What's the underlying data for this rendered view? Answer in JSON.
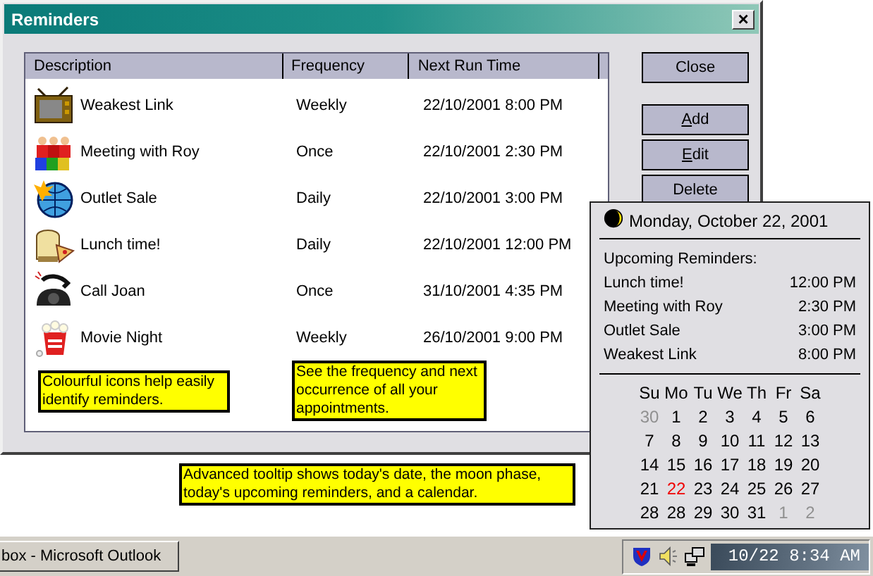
{
  "window": {
    "title": "Reminders",
    "close_glyph": "×"
  },
  "table": {
    "columns": [
      "Description",
      "Frequency",
      "Next Run Time"
    ],
    "rows": [
      {
        "kind": "tv",
        "description": "Weakest Link",
        "frequency": "Weekly",
        "next_run": "22/10/2001 8:00 PM"
      },
      {
        "kind": "people",
        "description": "Meeting with Roy",
        "frequency": "Once",
        "next_run": "22/10/2001 2:30 PM"
      },
      {
        "kind": "globe",
        "description": "Outlet Sale",
        "frequency": "Daily",
        "next_run": "22/10/2001 3:00 PM"
      },
      {
        "kind": "food",
        "description": "Lunch time!",
        "frequency": "Daily",
        "next_run": "22/10/2001 12:00 PM"
      },
      {
        "kind": "phone",
        "description": "Call Joan",
        "frequency": "Once",
        "next_run": "31/10/2001 4:35 PM"
      },
      {
        "kind": "popcorn",
        "description": "Movie Night",
        "frequency": "Weekly",
        "next_run": "26/10/2001 9:00 PM"
      }
    ]
  },
  "buttons": [
    {
      "label": "Close",
      "mnemonic": false
    },
    {
      "label": "Add",
      "mnemonic": true
    },
    {
      "label": "Edit",
      "mnemonic": true
    },
    {
      "label": "Delete",
      "mnemonic": false
    }
  ],
  "callouts": [
    "Colourful icons help easily identify reminders.",
    "See the frequency and next occurrence of all your appointments.",
    "Advanced tooltip shows today's date, the moon phase, today's upcoming reminders, and a calendar."
  ],
  "tooltip": {
    "date": "Monday, October 22, 2001",
    "upcoming_title": "Upcoming Reminders:",
    "upcoming": [
      {
        "name": "Lunch time!",
        "time": "12:00 PM"
      },
      {
        "name": "Meeting with Roy",
        "time": "2:30 PM"
      },
      {
        "name": "Outlet Sale",
        "time": "3:00 PM"
      },
      {
        "name": "Weakest Link",
        "time": "8:00 PM"
      }
    ],
    "calendar": {
      "weekdays": [
        "Su",
        "Mo",
        "Tu",
        "We",
        "Th",
        "Fr",
        "Sa"
      ],
      "weeks": [
        [
          {
            "day": "30",
            "kind": "other"
          },
          {
            "day": "1",
            "kind": "current"
          },
          {
            "day": "2",
            "kind": "current"
          },
          {
            "day": "3",
            "kind": "current"
          },
          {
            "day": "4",
            "kind": "current"
          },
          {
            "day": "5",
            "kind": "current"
          },
          {
            "day": "6",
            "kind": "current"
          }
        ],
        [
          {
            "day": "7",
            "kind": "current"
          },
          {
            "day": "8",
            "kind": "current"
          },
          {
            "day": "9",
            "kind": "current"
          },
          {
            "day": "10",
            "kind": "current"
          },
          {
            "day": "11",
            "kind": "current"
          },
          {
            "day": "12",
            "kind": "current"
          },
          {
            "day": "13",
            "kind": "current"
          }
        ],
        [
          {
            "day": "14",
            "kind": "current"
          },
          {
            "day": "15",
            "kind": "current"
          },
          {
            "day": "16",
            "kind": "current"
          },
          {
            "day": "17",
            "kind": "current"
          },
          {
            "day": "18",
            "kind": "current"
          },
          {
            "day": "19",
            "kind": "current"
          },
          {
            "day": "20",
            "kind": "current"
          }
        ],
        [
          {
            "day": "21",
            "kind": "current"
          },
          {
            "day": "22",
            "kind": "today"
          },
          {
            "day": "23",
            "kind": "current"
          },
          {
            "day": "24",
            "kind": "current"
          },
          {
            "day": "25",
            "kind": "current"
          },
          {
            "day": "26",
            "kind": "current"
          },
          {
            "day": "27",
            "kind": "current"
          }
        ],
        [
          {
            "day": "28",
            "kind": "current"
          },
          {
            "day": "28",
            "kind": "current"
          },
          {
            "day": "29",
            "kind": "current"
          },
          {
            "day": "30",
            "kind": "current"
          },
          {
            "day": "31",
            "kind": "current"
          },
          {
            "day": "1",
            "kind": "other"
          },
          {
            "day": "2",
            "kind": "other"
          }
        ]
      ]
    }
  },
  "taskbar": {
    "button": "box - Microsoft Outlook",
    "clock": "10/22 8:34 AM"
  }
}
